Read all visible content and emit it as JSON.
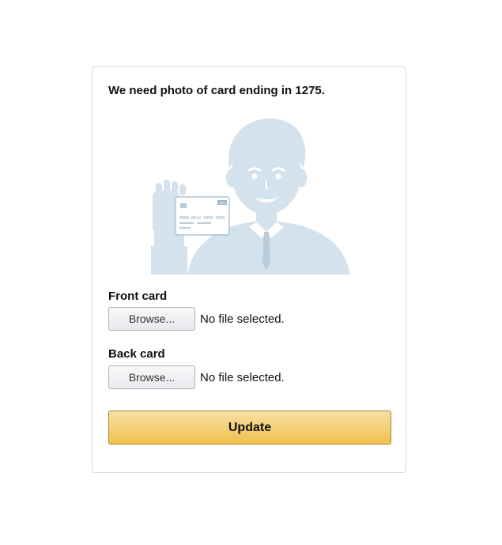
{
  "heading": "We need photo of card ending in 1275.",
  "illustration": {
    "card_number": "4000 0012 3456 7899",
    "card_brand": "VISA",
    "color": "#d4e2ed"
  },
  "front": {
    "label": "Front card",
    "browse_label": "Browse...",
    "status": "No file selected."
  },
  "back": {
    "label": "Back card",
    "browse_label": "Browse...",
    "status": "No file selected."
  },
  "update_label": "Update"
}
